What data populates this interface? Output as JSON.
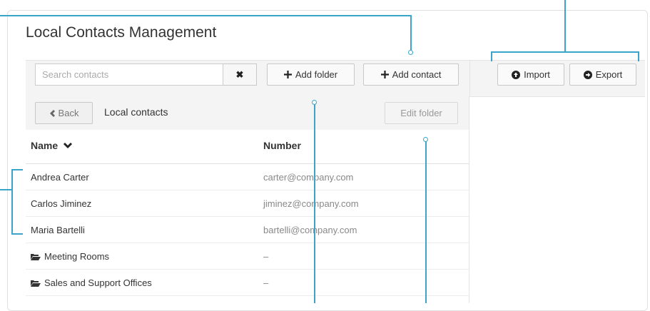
{
  "page": {
    "title": "Local Contacts Management"
  },
  "toolbar": {
    "search_placeholder": "Search contacts",
    "clear_symbol": "✖",
    "add_folder_label": "Add folder",
    "add_contact_label": "Add contact",
    "import_label": "Import",
    "export_label": "Export"
  },
  "nav": {
    "back_label": "Back",
    "breadcrumb": "Local contacts",
    "edit_folder_label": "Edit folder"
  },
  "table": {
    "columns": {
      "name": "Name",
      "number": "Number"
    },
    "rows": [
      {
        "name": "Andrea Carter",
        "number": "carter@company.com",
        "type": "contact"
      },
      {
        "name": "Carlos Jiminez",
        "number": "jiminez@company.com",
        "type": "contact"
      },
      {
        "name": "Maria Bartelli",
        "number": "bartelli@company.com",
        "type": "contact"
      },
      {
        "name": "Meeting Rooms",
        "number": "–",
        "type": "folder"
      },
      {
        "name": "Sales and Support Offices",
        "number": "–",
        "type": "folder"
      }
    ]
  },
  "icons": {
    "clear": "close-icon",
    "add": "plus-icon",
    "import": "circle-arrow-up-icon",
    "export": "circle-arrow-right-icon",
    "back": "chevron-left-icon",
    "sort": "chevron-down-icon",
    "folder": "folder-open-icon"
  },
  "colors": {
    "callout": "#3aa4c9"
  }
}
